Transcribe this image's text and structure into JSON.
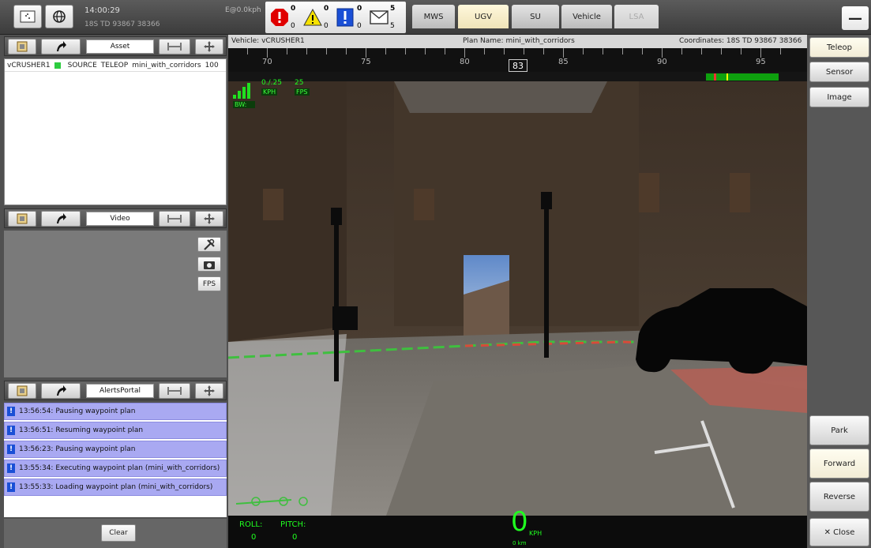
{
  "topbar": {
    "time": "14:00:29",
    "grid_coord": "18S TD 93867 38366",
    "position_readout": "E@0.0kph",
    "alerts": {
      "critical": {
        "top": "0",
        "bottom": "0"
      },
      "warning": {
        "top": "0",
        "bottom": "0"
      },
      "info": {
        "top": "0",
        "bottom": "0"
      },
      "messages": {
        "top": "5",
        "bottom": "5"
      }
    },
    "tabs": [
      "MWS",
      "UGV",
      "SU",
      "Vehicle",
      "LSA"
    ],
    "active_tab": "UGV",
    "minimize_label": "—"
  },
  "asset_panel": {
    "title": "Asset",
    "rows": [
      {
        "name": "vCRUSHER1",
        "source": "SOURCE",
        "mode": "TELEOP",
        "plan": "mini_with_corridors",
        "value": "100"
      }
    ]
  },
  "video_panel": {
    "title": "Video",
    "fps_label": "FPS"
  },
  "alerts_panel": {
    "title": "AlertsPortal",
    "rows": [
      {
        "icon": "!",
        "text": "13:56:54: Pausing waypoint plan"
      },
      {
        "icon": "!",
        "text": "13:56:51: Resuming waypoint plan"
      },
      {
        "icon": "!",
        "text": "13:56:23: Pausing waypoint plan"
      },
      {
        "icon": "!",
        "text": "13:55:34: Executing waypoint plan (mini_with_corridors)"
      },
      {
        "icon": "!",
        "text": "13:55:33: Loading waypoint plan (mini_with_corridors)"
      }
    ],
    "clear_label": "Clear"
  },
  "camera": {
    "vehicle": "Vehicle:  vCRUSHER1",
    "plan_name": "Plan Name:  mini_with_corridors",
    "coordinates": "Coordinates:  18S TD 93867 38366",
    "compass_labels": [
      "70",
      "75",
      "80",
      "85",
      "90",
      "95"
    ],
    "heading": "83",
    "speed_readout": "0./.25",
    "speed_unit": "KPH",
    "fps_value": "25",
    "fps_unit": "FPS",
    "bandwidth_label": "BW:",
    "roll_label": "ROLL:",
    "roll_value": "0",
    "pitch_label": "PITCH:",
    "pitch_value": "0",
    "speed_big": "0",
    "speed_big_unit": "KPH",
    "distance": "0 km"
  },
  "right_panel": {
    "top_buttons": [
      "Teleop",
      "Sensor",
      "Image"
    ],
    "active_top": "Teleop",
    "bottom_buttons": [
      "Park",
      "Forward",
      "Reverse"
    ],
    "active_bottom": "Forward",
    "close_label": "✕ Close"
  }
}
